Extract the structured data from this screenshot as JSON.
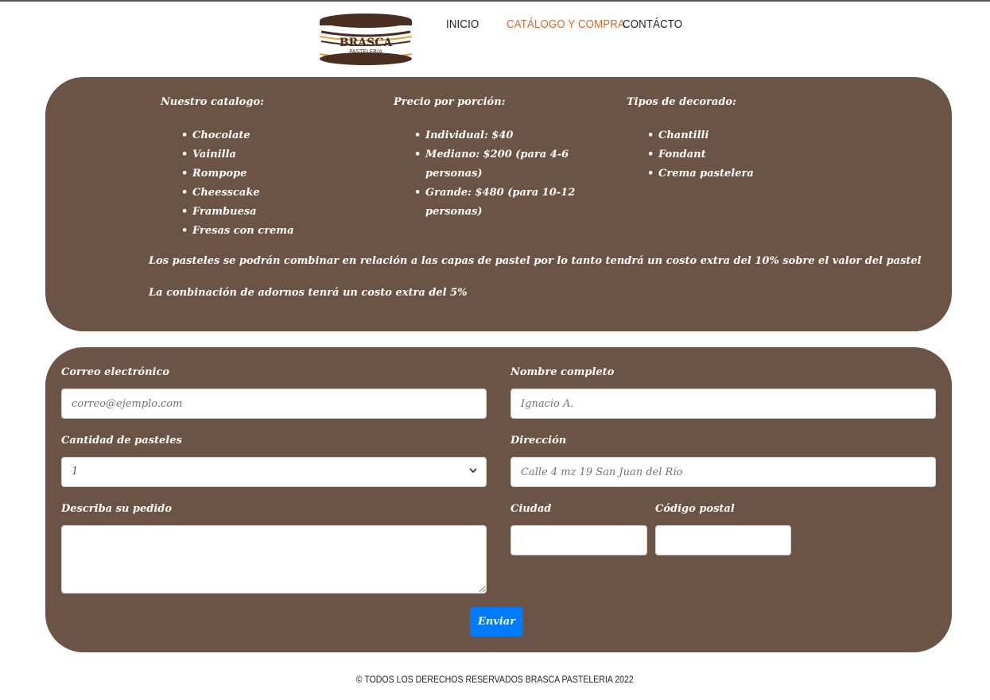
{
  "header": {
    "logo": {
      "brand": "BRASCA",
      "sub": "PASTELERIA"
    },
    "nav": [
      {
        "label": "INICIO"
      },
      {
        "label": "CATÁLOGO Y COMPRA",
        "active": true
      },
      {
        "label": "CONTÁCTO"
      }
    ]
  },
  "info": {
    "catalog": {
      "title": "Nuestro catalogo:",
      "items": [
        "Chocolate",
        "Vainilla",
        "Rompope",
        "Cheesscake",
        "Frambuesa",
        "Fresas con crema"
      ]
    },
    "prices": {
      "title": "Precio por porción:",
      "items": [
        "Individual: $40",
        "Mediano: $200 (para 4-6 personas)",
        "Grande: $480 (para 10-12 personas)"
      ]
    },
    "decor": {
      "title": "Tipos de decorado:",
      "items": [
        "Chantilli",
        "Fondant",
        "Crema pastelera"
      ]
    },
    "note_1": "Los pasteles se podrán combinar en relación a las capas de pastel por lo tanto tendrá un costo extra del 10% sobre el valor del pastel",
    "note_2": "La conbinación de adornos tenrá un costo extra del 5%"
  },
  "form": {
    "email": {
      "label": "Correo electrónico",
      "placeholder": "correo@ejemplo.com"
    },
    "name": {
      "label": "Nombre completo",
      "placeholder": "Ignacio A."
    },
    "quantity": {
      "label": "Cantidad de pasteles",
      "value": "1"
    },
    "address": {
      "label": "Dirección",
      "placeholder": "Calle 4 mz 19 San Juan del Río"
    },
    "description": {
      "label": "Describa su pedido"
    },
    "city": {
      "label": "Ciudad"
    },
    "zip": {
      "label": "Código postal"
    },
    "submit_label": "Enviar"
  },
  "footer": {
    "text": "© TODOS LOS DERECHOS RESERVADOS BRASCA PASTELERIA 2022"
  },
  "colors": {
    "panel": "#6b5446",
    "accent_nav": "#e0662b",
    "button": "#007bff",
    "logo_brown": "#4a2e1f",
    "logo_orange": "#f0a040"
  }
}
